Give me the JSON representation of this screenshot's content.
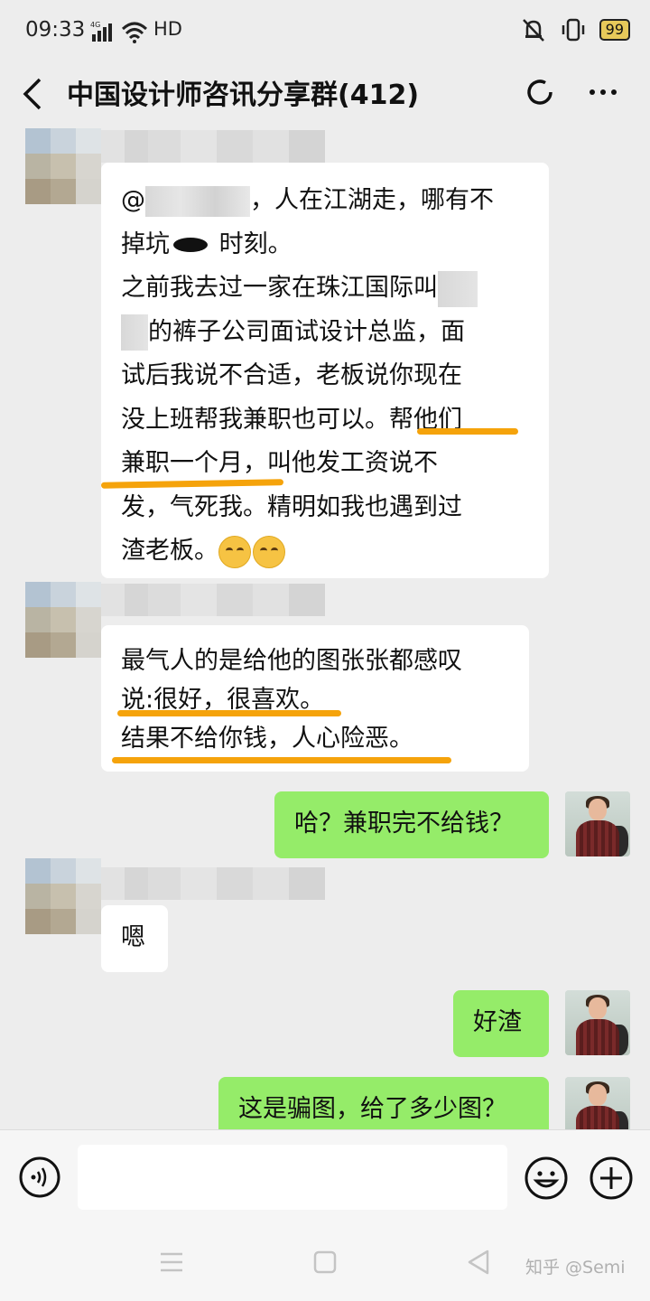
{
  "status_bar": {
    "time": "09:33",
    "network": "HD",
    "battery": "99"
  },
  "nav": {
    "title": "中国设计师咨讯分享群(412)"
  },
  "messages": [
    {
      "side": "incoming",
      "lines": [
        {
          "pre": "@",
          "post": "，人在江湖走，哪有不"
        },
        {
          "pre": "掉坑",
          "post": " 时刻。"
        },
        {
          "text": "之前我去过一家在珠江国际叫"
        },
        {
          "text": "的裤子公司面试设计总监，面"
        },
        {
          "text": "试后我说不合适，老板说你现在"
        },
        {
          "pre": "没上班帮我兼职也可以。",
          "post": "帮他们"
        },
        {
          "pre": "兼职一个月，",
          "post": "叫他发工资说不"
        },
        {
          "text": "发，气死我。精明如我也遇到过"
        },
        {
          "text": "渣老板。"
        }
      ]
    },
    {
      "side": "incoming",
      "lines": [
        {
          "text": "最气人的是给他的图张张都感叹"
        },
        {
          "text": "说:很好，很喜欢。"
        },
        {
          "text": "结果不给你钱，人心险恶。"
        }
      ]
    },
    {
      "side": "outgoing",
      "text": "哈？兼职完不给钱？"
    },
    {
      "side": "incoming",
      "text": "嗯"
    },
    {
      "side": "outgoing",
      "text": "好渣"
    },
    {
      "side": "outgoing",
      "text": "这是骗图，给了多少图？"
    }
  ],
  "input_bar": {
    "voice_icon": "voice-icon",
    "emoji_icon": "emoji-icon",
    "plus_icon": "plus-icon"
  },
  "watermark": "知乎 @Semi",
  "colors": {
    "background": "#ededed",
    "incoming_bubble": "#ffffff",
    "outgoing_bubble": "#95ec69",
    "highlight_underline": "#f5a30b"
  }
}
